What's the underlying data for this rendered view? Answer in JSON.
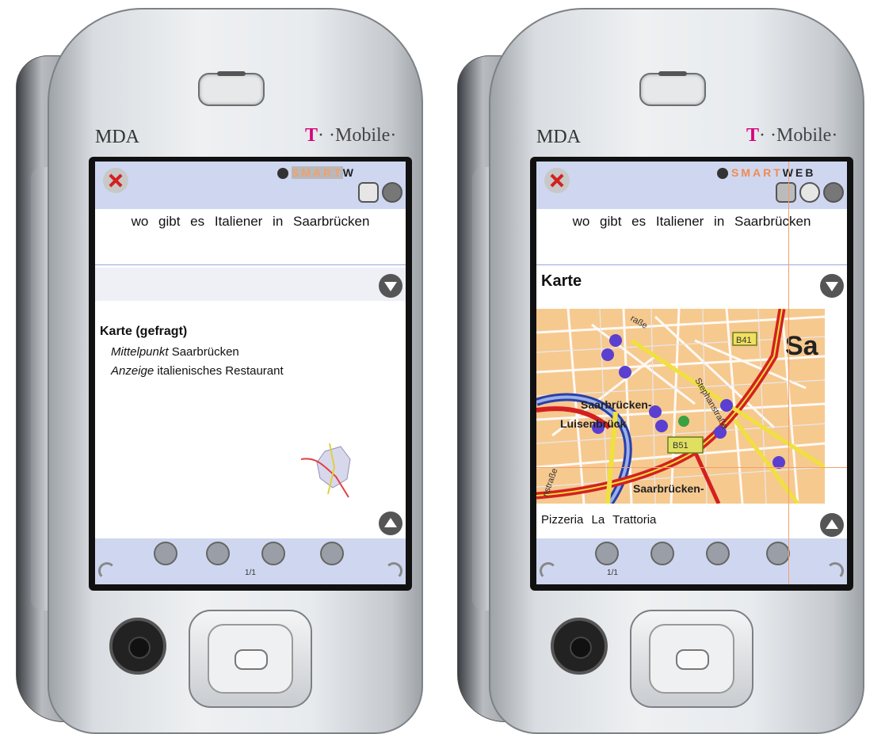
{
  "left_device": {
    "brand_left": "MDA",
    "brand_t": "T",
    "brand_right": "· ·Mobile·",
    "logo_smart": "SMART",
    "logo_web": "W",
    "query": "wo gibt es Italiener in Saarbrücken",
    "result_title": "Karte (gefragt)",
    "line1_key": "Mittelpunkt",
    "line1_val": " Saarbrücken",
    "line2_key": "Anzeige",
    "line2_val": " italienisches Restaurant",
    "page": "1/1"
  },
  "right_device": {
    "brand_left": "MDA",
    "brand_t": "T",
    "brand_right": "· ·Mobile·",
    "logo_smart": "SMART",
    "logo_web": "WEB",
    "query": "wo gibt es Italiener in Saarbrücken",
    "section_title": "Karte",
    "result": "Pizzeria La Trattoria",
    "page": "1/1",
    "map_labels": {
      "road_badge": "B41",
      "city_big": "Sa",
      "district1": "Saarbrücken-",
      "district2": "Luisenbrück",
      "district3": "Saarbrücken-",
      "street1": "raße",
      "street2": "Stephanstraße",
      "street3": "nstraße",
      "marker_badge": "B51"
    }
  },
  "colors": {
    "toolbar": "#cfd7f0",
    "logo_smart": "#f08a50",
    "brand_t": "#d4007a",
    "map_bg": "#f6c98f",
    "road_red": "#d42020",
    "road_yellow": "#f0e040",
    "river": "#2a3fa8",
    "marker": "#5a3fd0"
  }
}
